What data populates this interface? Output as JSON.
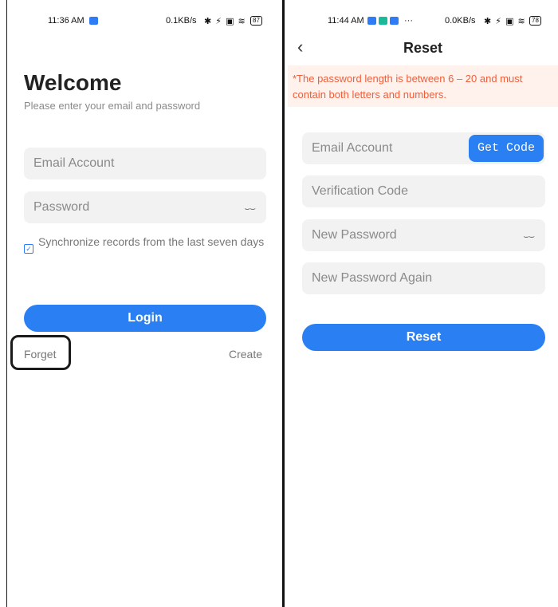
{
  "left": {
    "status": {
      "time": "11:36 AM",
      "speed": "0.1KB/s",
      "battery": "87"
    },
    "title": "Welcome",
    "subtitle": "Please enter your email and password",
    "email_placeholder": "Email Account",
    "password_placeholder": "Password",
    "sync_label": "Synchronize records from the last seven days",
    "login_label": "Login",
    "forget_label": "Forget",
    "create_label": "Create",
    "colors": {
      "accent": "#2a7ff3",
      "field_bg": "#f2f2f2"
    },
    "icons": [
      "eye-closed-icon",
      "checkbox-icon"
    ]
  },
  "right": {
    "status": {
      "time": "11:44 AM",
      "dots": "···",
      "speed": "0.0KB/s",
      "battery": "78"
    },
    "title": "Reset",
    "back_icon": "chevron-left-icon",
    "notice": "*The password length is between 6 – 20 and must contain both letters and numbers.",
    "email_placeholder": "Email Account",
    "get_code_label": "Get Code",
    "code_placeholder": "Verification Code",
    "new_password_placeholder": "New Password",
    "new_password_again_placeholder": "New Password Again",
    "reset_label": "Reset",
    "colors": {
      "notice_bg": "#fff1ec",
      "notice_text": "#ee5f3c"
    }
  }
}
